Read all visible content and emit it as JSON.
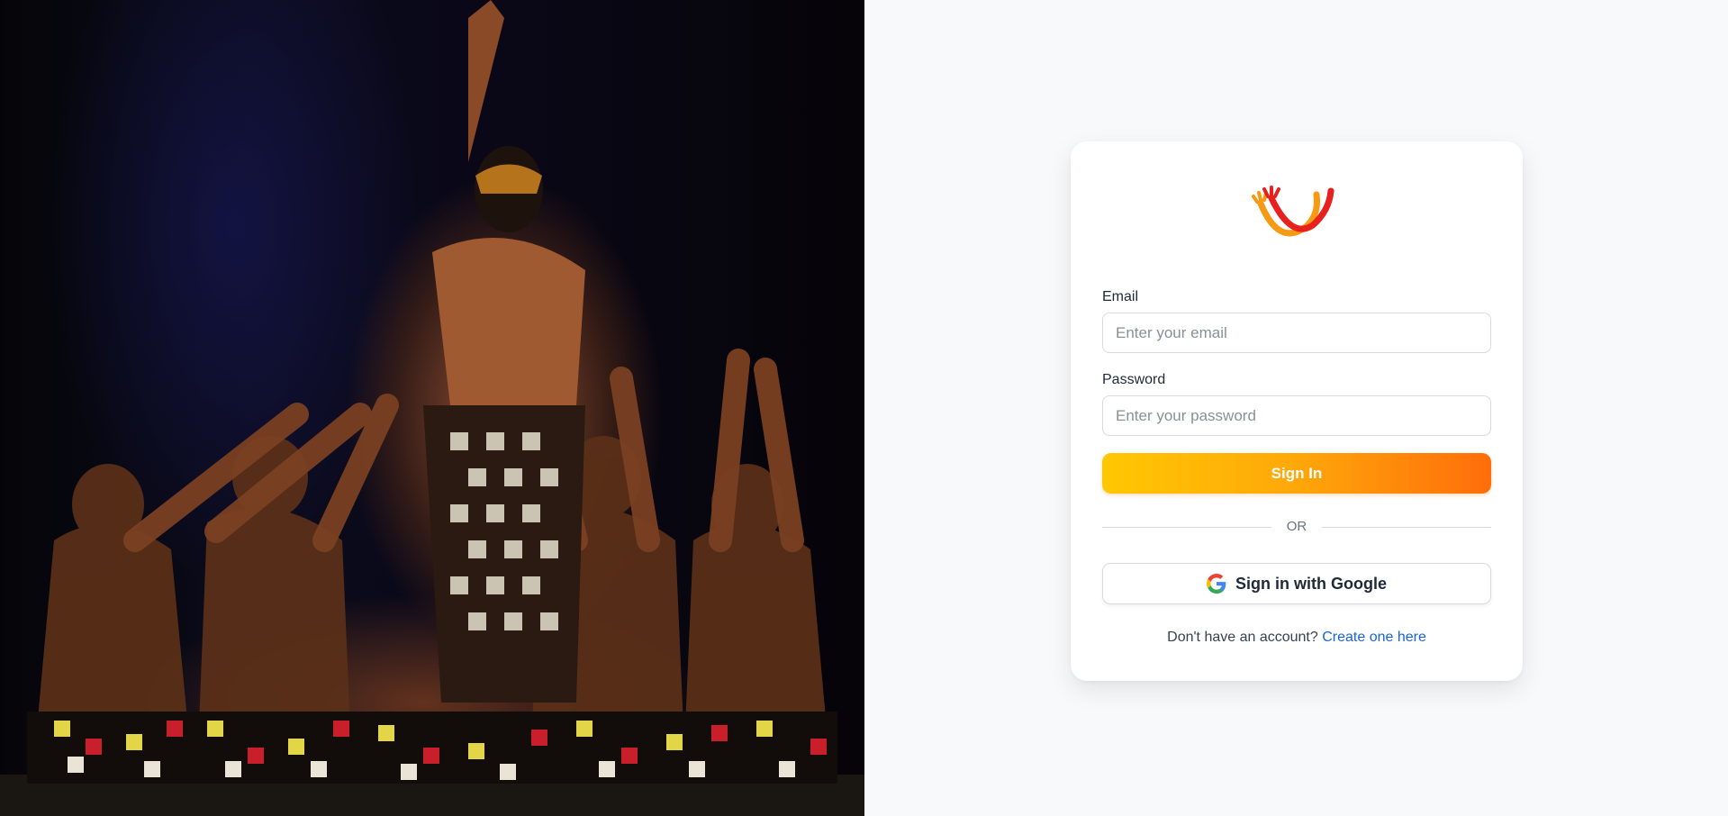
{
  "form": {
    "email_label": "Email",
    "email_placeholder": "Enter your email",
    "email_value": "",
    "password_label": "Password",
    "password_placeholder": "Enter your password",
    "password_value": "",
    "signin_label": "Sign In",
    "divider_text": "OR",
    "google_label": "Sign in with Google",
    "signup_prompt": "Don't have an account?",
    "signup_link": "Create one here"
  },
  "icons": {
    "logo": "hand-wave-logo",
    "google": "google-g-icon"
  },
  "colors": {
    "accent_start": "#ffc703",
    "accent_end": "#ff6d0b",
    "link": "#1a63d6",
    "logo_orange": "#f59a12",
    "logo_red": "#e8201e"
  }
}
